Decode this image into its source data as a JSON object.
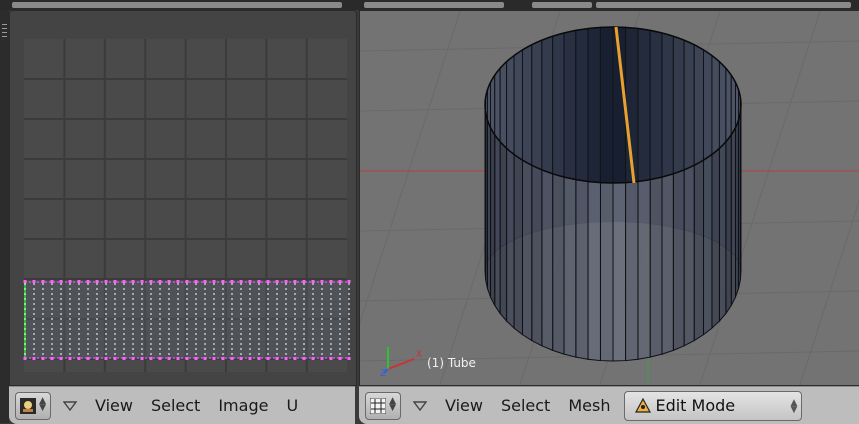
{
  "uv_editor": {
    "editor_type_icon": "image-editor-icon",
    "menu": [
      "View",
      "Select",
      "Image",
      "U"
    ]
  },
  "viewport": {
    "object_label": "(1) Tube",
    "axis_labels": {
      "x": "X",
      "z": "Z"
    },
    "editor_type_icon": "grid-icon",
    "menu": [
      "View",
      "Select",
      "Mesh"
    ],
    "mode": "Edit Mode",
    "mode_icon": "edit-mode-icon"
  },
  "colors": {
    "seam": "#e8a030",
    "uv_vertex": "#ff60ff",
    "x_axis": "#d03030",
    "y_axis": "#30c030",
    "z_axis": "#3060e0"
  }
}
